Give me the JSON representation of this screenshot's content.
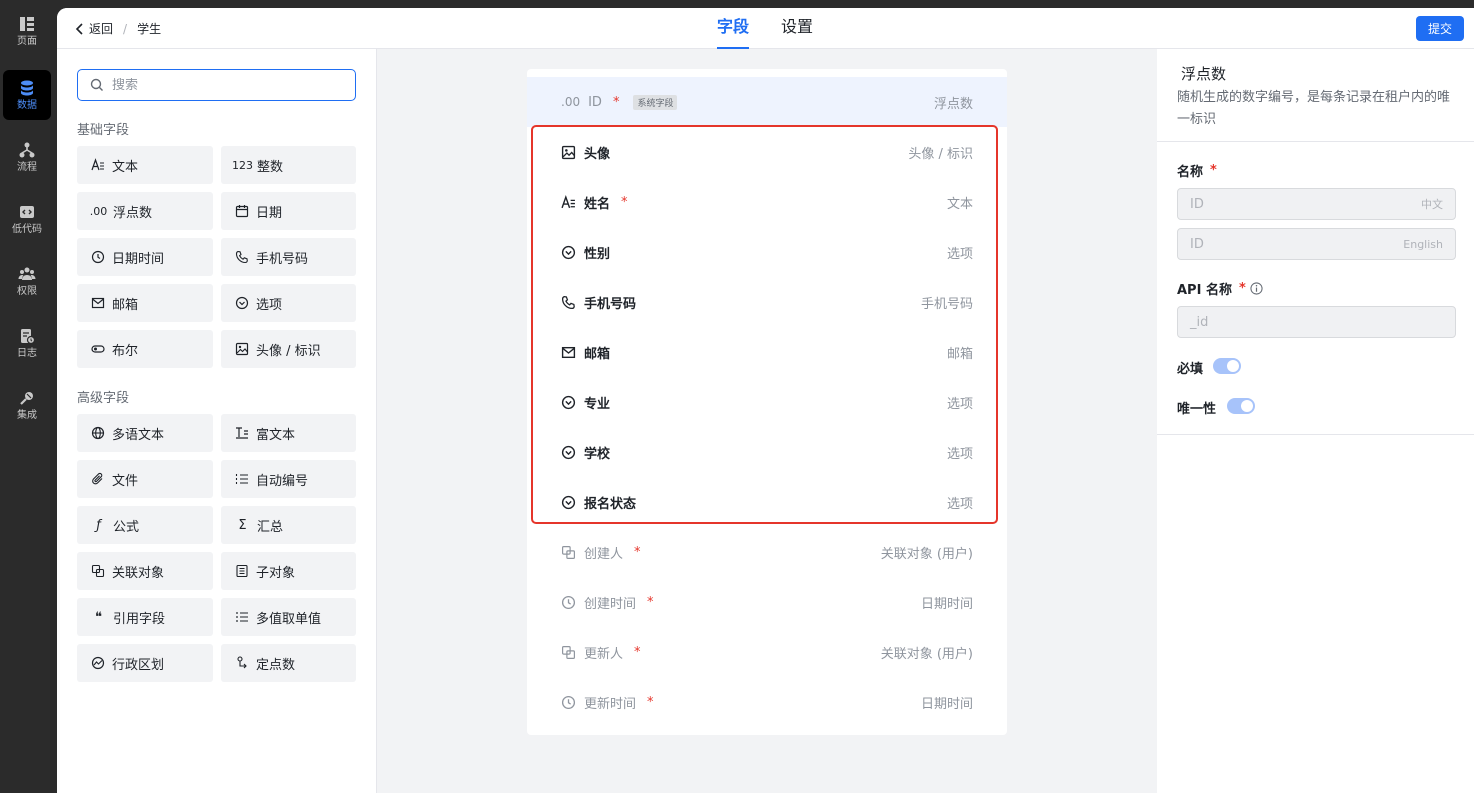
{
  "rail": [
    {
      "label": "页面",
      "icon": "layout-icon"
    },
    {
      "label": "数据",
      "icon": "database-icon",
      "active": true
    },
    {
      "label": "流程",
      "icon": "flow-icon"
    },
    {
      "label": "低代码",
      "icon": "code-icon"
    },
    {
      "label": "权限",
      "icon": "users-icon"
    },
    {
      "label": "日志",
      "icon": "log-icon"
    },
    {
      "label": "集成",
      "icon": "plug-icon"
    }
  ],
  "header": {
    "back_label": "返回",
    "breadcrumb": "学生",
    "tabs": [
      "字段",
      "设置"
    ],
    "submit_label": "提交"
  },
  "left": {
    "search_placeholder": "搜索",
    "basic_title": "基础字段",
    "basic": [
      {
        "label": "文本",
        "icon": "text-icon"
      },
      {
        "label": "整数",
        "icon": "integer-icon",
        "glyph": "123"
      },
      {
        "label": "浮点数",
        "icon": "float-icon",
        "glyph": ".00"
      },
      {
        "label": "日期",
        "icon": "calendar-icon"
      },
      {
        "label": "日期时间",
        "icon": "clock-icon"
      },
      {
        "label": "手机号码",
        "icon": "phone-icon"
      },
      {
        "label": "邮箱",
        "icon": "mail-icon"
      },
      {
        "label": "选项",
        "icon": "option-icon"
      },
      {
        "label": "布尔",
        "icon": "toggle-icon"
      },
      {
        "label": "头像 / 标识",
        "icon": "image-icon"
      }
    ],
    "advanced_title": "高级字段",
    "advanced": [
      {
        "label": "多语文本",
        "icon": "globe-icon"
      },
      {
        "label": "富文本",
        "icon": "richtext-icon"
      },
      {
        "label": "文件",
        "icon": "paperclip-icon"
      },
      {
        "label": "自动编号",
        "icon": "numbered-list-icon"
      },
      {
        "label": "公式",
        "icon": "formula-icon",
        "glyph": "ƒ"
      },
      {
        "label": "汇总",
        "icon": "sigma-icon",
        "glyph": "Σ"
      },
      {
        "label": "关联对象",
        "icon": "link-object-icon"
      },
      {
        "label": "子对象",
        "icon": "sub-object-icon"
      },
      {
        "label": "引用字段",
        "icon": "quote-icon",
        "glyph": "❝"
      },
      {
        "label": "多值取单值",
        "icon": "list-icon"
      },
      {
        "label": "行政区划",
        "icon": "region-icon"
      },
      {
        "label": "定点数",
        "icon": "decimal-icon"
      }
    ]
  },
  "fields": [
    {
      "name": "ID",
      "type": "浮点数",
      "icon": "float-icon",
      "glyph": ".00",
      "required": true,
      "badge": "系统字段",
      "state": "selected"
    },
    {
      "name": "头像",
      "type": "头像 / 标识",
      "icon": "image-icon",
      "required": false,
      "state": "custom"
    },
    {
      "name": "姓名",
      "type": "文本",
      "icon": "text-icon",
      "required": true,
      "state": "custom"
    },
    {
      "name": "性别",
      "type": "选项",
      "icon": "option-icon",
      "required": false,
      "state": "custom"
    },
    {
      "name": "手机号码",
      "type": "手机号码",
      "icon": "phone-icon",
      "required": false,
      "state": "custom"
    },
    {
      "name": "邮箱",
      "type": "邮箱",
      "icon": "mail-icon",
      "required": false,
      "state": "custom"
    },
    {
      "name": "专业",
      "type": "选项",
      "icon": "option-icon",
      "required": false,
      "state": "custom"
    },
    {
      "name": "学校",
      "type": "选项",
      "icon": "option-icon",
      "required": false,
      "state": "custom"
    },
    {
      "name": "报名状态",
      "type": "选项",
      "icon": "option-icon",
      "required": false,
      "state": "custom"
    },
    {
      "name": "创建人",
      "type": "关联对象 (用户)",
      "icon": "link-object-icon",
      "required": true,
      "state": "system"
    },
    {
      "name": "创建时间",
      "type": "日期时间",
      "icon": "clock-icon",
      "required": true,
      "state": "system"
    },
    {
      "name": "更新人",
      "type": "关联对象 (用户)",
      "icon": "link-object-icon",
      "required": true,
      "state": "system"
    },
    {
      "name": "更新时间",
      "type": "日期时间",
      "icon": "clock-icon",
      "required": true,
      "state": "system"
    }
  ],
  "detail": {
    "title": "浮点数",
    "description": "随机生成的数字编号，是每条记录在租户内的唯一标识",
    "name_label": "名称",
    "name_zh_value": "ID",
    "name_zh_hint": "中文",
    "name_en_value": "ID",
    "name_en_hint": "English",
    "api_label": "API 名称",
    "api_value": "_id",
    "required_label": "必填",
    "required_on": true,
    "unique_label": "唯一性",
    "unique_on": true
  },
  "colors": {
    "accent": "#1f6ef3",
    "danger": "#e5352b",
    "rail_bg": "#2b2b2b"
  }
}
